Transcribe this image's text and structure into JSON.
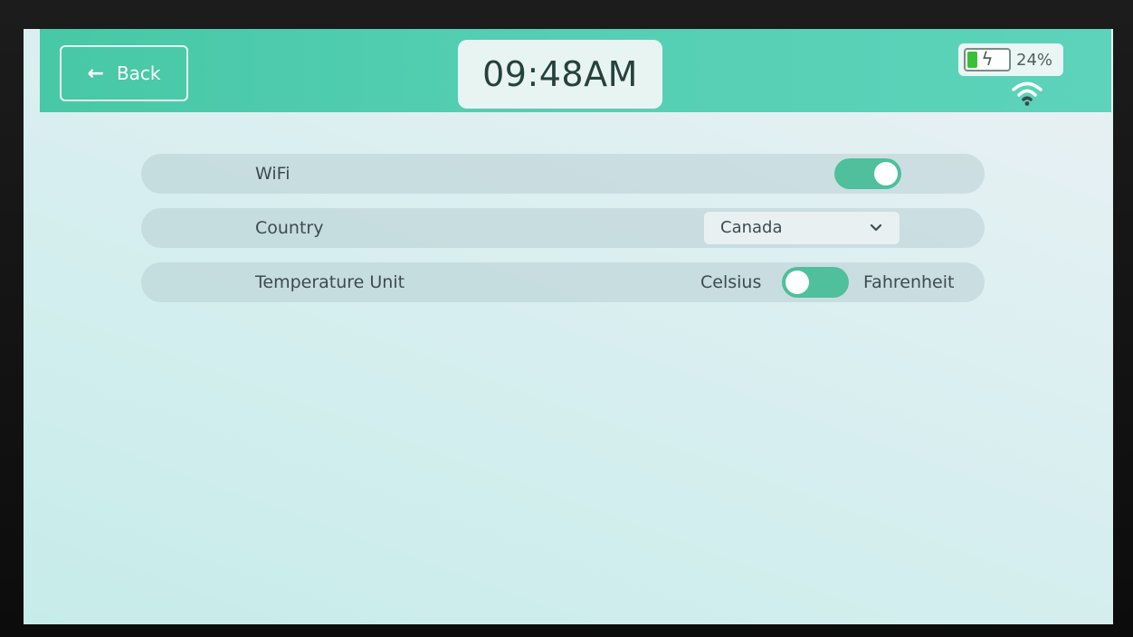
{
  "header": {
    "back_label": "Back",
    "time": "09:48AM",
    "battery_percent_text": "24%",
    "battery_level": 0.24,
    "accent_color": "#4fc9a9"
  },
  "settings": [
    {
      "label": "WiFi",
      "control": "toggle",
      "on": true
    },
    {
      "label": "Country",
      "control": "select",
      "value": "Canada"
    },
    {
      "label": "Temperature Unit",
      "control": "unit-toggle",
      "left_option": "Celsius",
      "right_option": "Fahrenheit",
      "selected": "Celsius"
    }
  ],
  "icons": [
    "arrow-left-icon",
    "battery-icon",
    "lightning-icon",
    "wifi-icon",
    "chevron-down-icon"
  ]
}
